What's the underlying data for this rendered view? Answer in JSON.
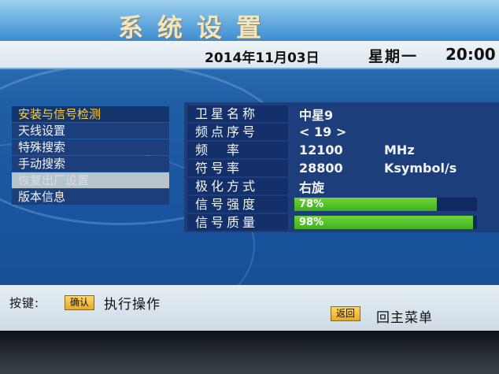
{
  "header": {
    "title": "系统设置"
  },
  "datebar": {
    "date": "2014年11月03日",
    "weekday": "星期一",
    "time": "20:00"
  },
  "menu": {
    "items": [
      {
        "label": "安装与信号检测",
        "state": "active"
      },
      {
        "label": "天线设置",
        "state": "normal"
      },
      {
        "label": "特殊搜索",
        "state": "normal"
      },
      {
        "label": "手动搜索",
        "state": "normal"
      },
      {
        "label": "恢复出厂设置",
        "state": "highlight"
      },
      {
        "label": "版本信息",
        "state": "normal"
      }
    ]
  },
  "info": {
    "satellite_label": "卫星名称",
    "satellite_value": "中星9",
    "tp_label": "频点序号",
    "tp_value": "< 19 >",
    "freq_label": "频　率",
    "freq_value": "12100",
    "freq_unit": "MHz",
    "symbol_label": "符号率",
    "symbol_value": "28800",
    "symbol_unit": "Ksymbol/s",
    "polar_label": "极化方式",
    "polar_value": "右旋",
    "strength_label": "信号强度",
    "strength_text": "78%",
    "strength_percent": 78,
    "quality_label": "信号质量",
    "quality_text": "98%",
    "quality_percent": 98
  },
  "footer": {
    "keys_label": "按键:",
    "ok_key": "确认",
    "ok_action": "执行操作",
    "back_key": "返回",
    "back_action": "回主菜单"
  },
  "colors": {
    "bar_fill": "#4cc02a",
    "active_menu_text": "#ffd23a",
    "key_chip": "#f0bf44"
  }
}
